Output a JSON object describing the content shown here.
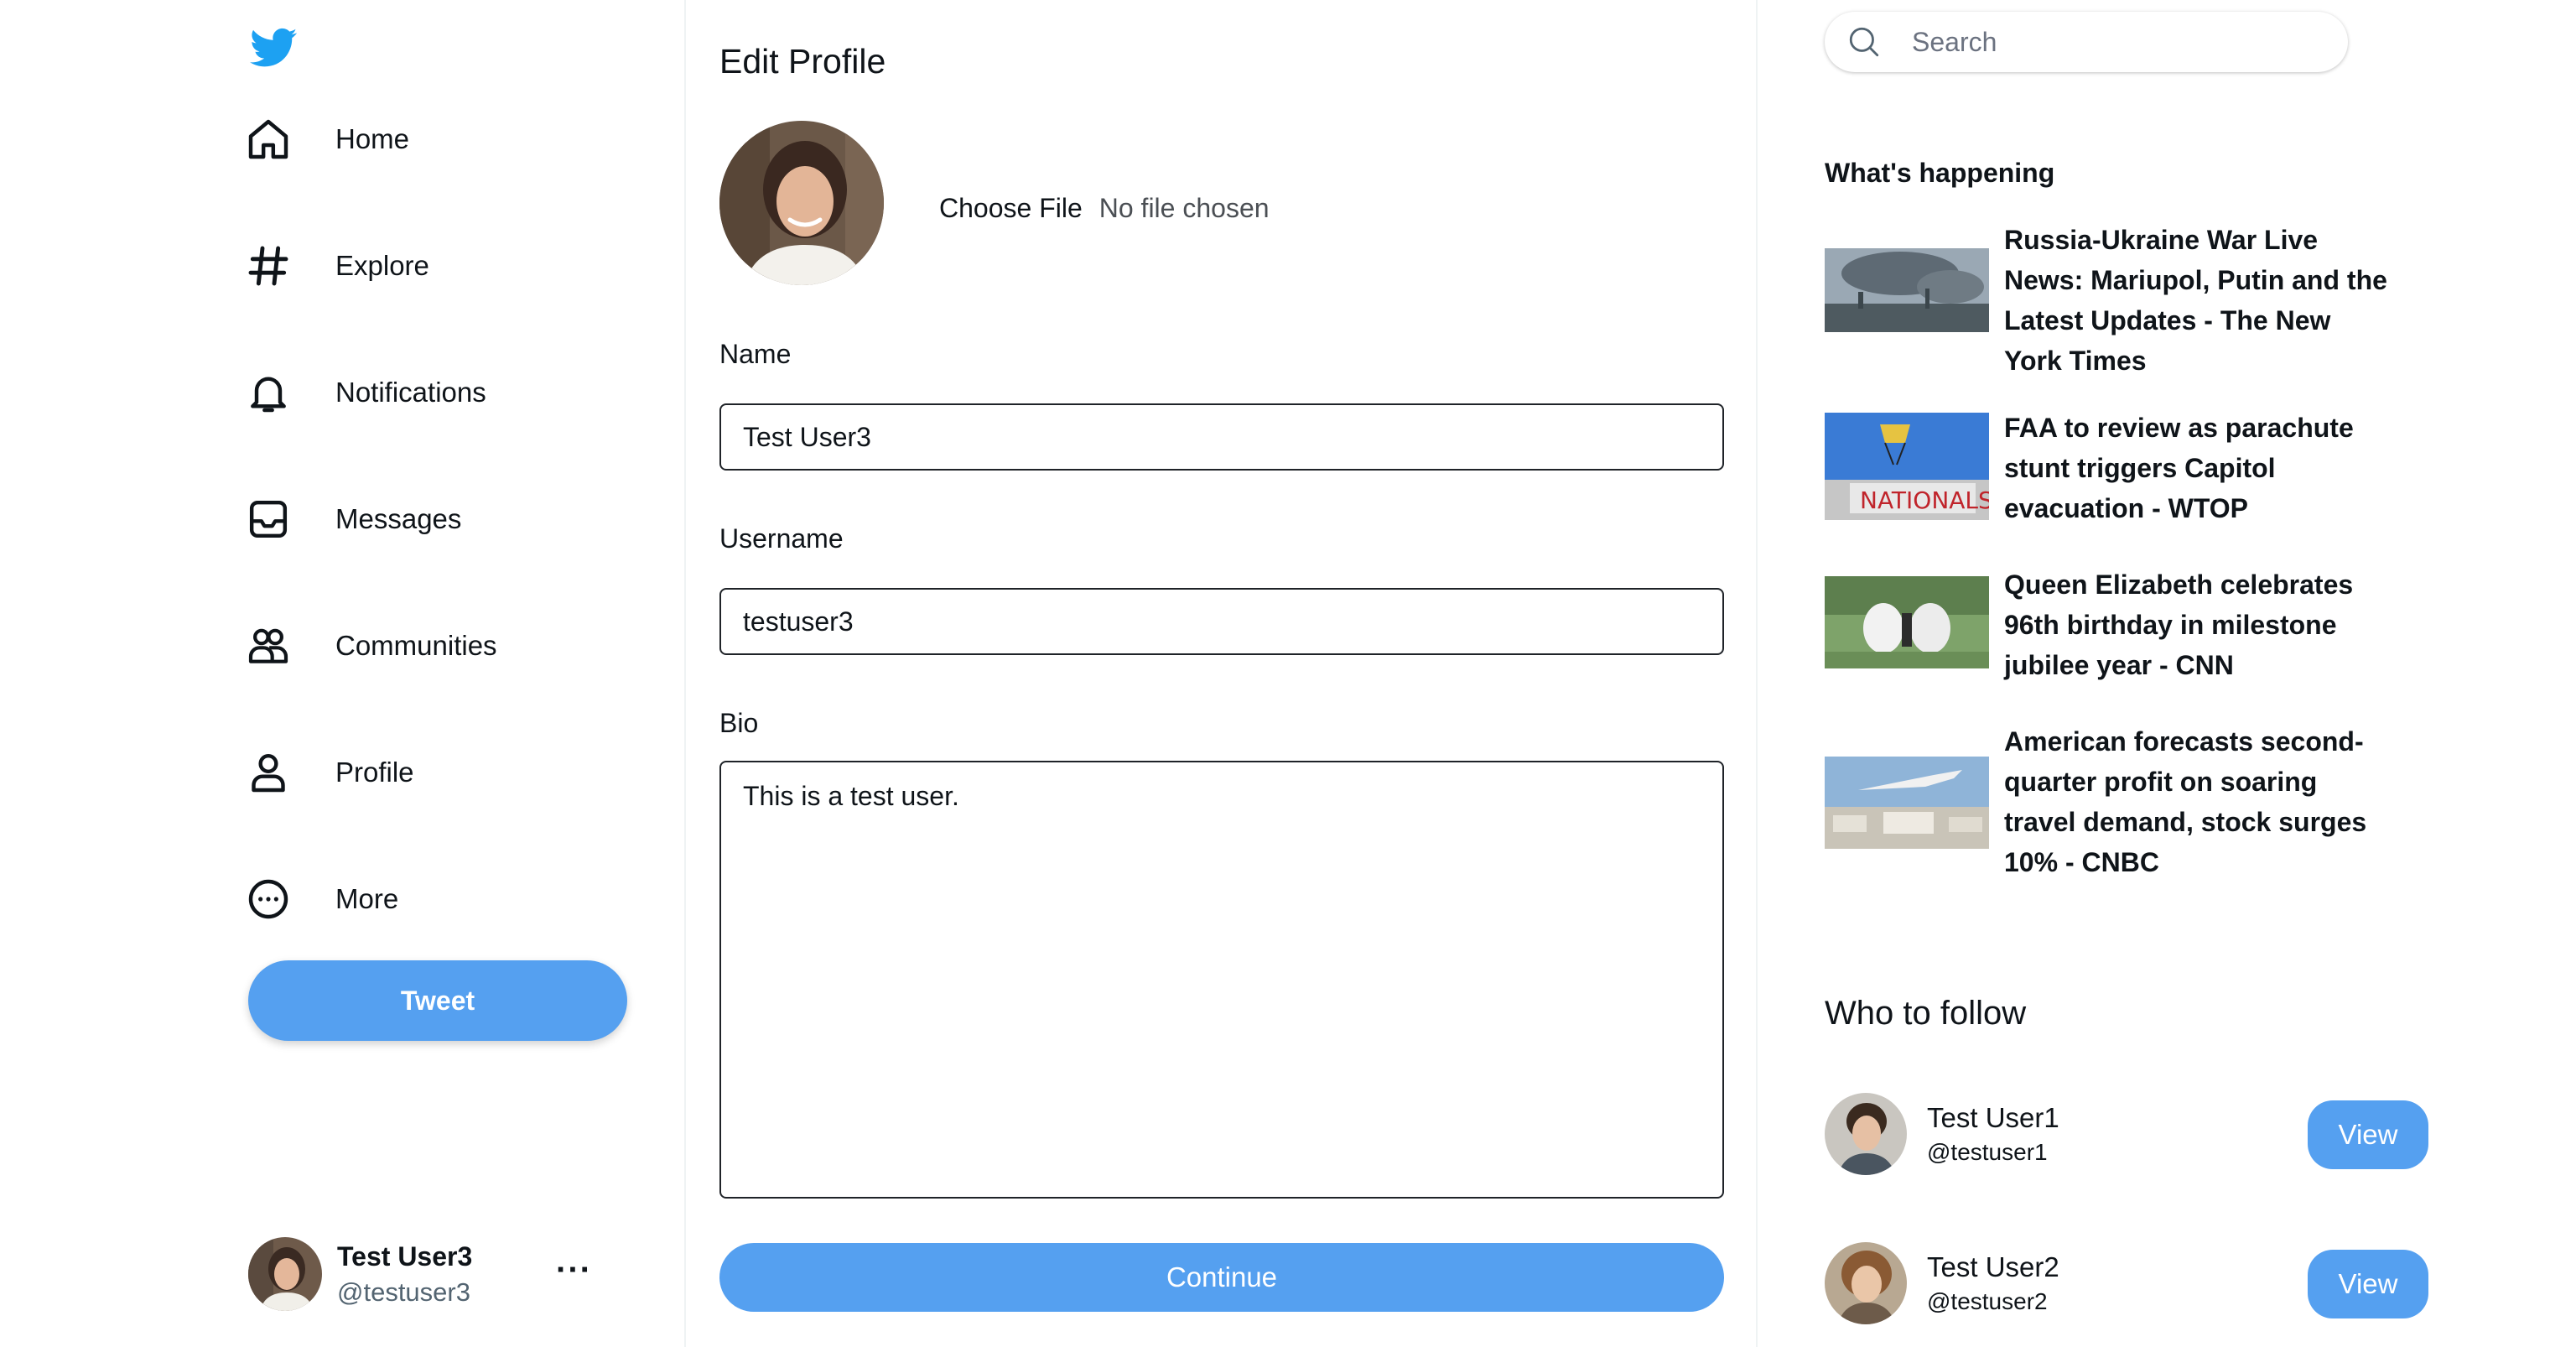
{
  "colors": {
    "accent": "#55a0f0",
    "twitter_blue": "#1da1f2",
    "text": "#0f1419",
    "muted": "#536471"
  },
  "sidebar": {
    "logo_icon": "twitter-bird-icon",
    "items": [
      {
        "label": "Home",
        "icon": "home-icon"
      },
      {
        "label": "Explore",
        "icon": "hashtag-icon"
      },
      {
        "label": "Notifications",
        "icon": "bell-icon"
      },
      {
        "label": "Messages",
        "icon": "inbox-icon"
      },
      {
        "label": "Communities",
        "icon": "communities-icon"
      },
      {
        "label": "Profile",
        "icon": "profile-icon"
      },
      {
        "label": "More",
        "icon": "more-circle-icon"
      }
    ],
    "tweet_label": "Tweet",
    "account": {
      "name": "Test User3",
      "handle": "@testuser3",
      "more": "···"
    }
  },
  "main": {
    "title": "Edit Profile",
    "file": {
      "choose_label": "Choose File",
      "status": "No file chosen"
    },
    "name_label": "Name",
    "name_value": "Test User3",
    "username_label": "Username",
    "username_value": "testuser3",
    "bio_label": "Bio",
    "bio_value": "This is a test user.",
    "continue_label": "Continue"
  },
  "right": {
    "search_placeholder": "Search",
    "happening_title": "What's happening",
    "news": [
      {
        "headline": "Russia-Ukraine War Live News: Mariupol, Putin and the Latest Updates - The New York Times"
      },
      {
        "headline": "FAA to review as parachute stunt triggers Capitol evacuation - WTOP"
      },
      {
        "headline": "Queen Elizabeth celebrates 96th birthday in milestone jubilee year - CNN"
      },
      {
        "headline": "American forecasts second-quarter profit on soaring travel demand, stock surges 10% - CNBC"
      }
    ],
    "follow_title": "Who to follow",
    "follow": [
      {
        "name": "Test User1",
        "handle": "@testuser1",
        "button": "View"
      },
      {
        "name": "Test User2",
        "handle": "@testuser2",
        "button": "View"
      }
    ]
  }
}
